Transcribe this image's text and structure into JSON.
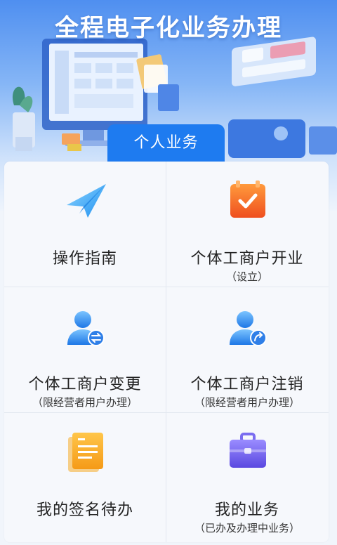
{
  "banner": {
    "title": "全程电子化业务办理"
  },
  "tab": {
    "label": "个人业务"
  },
  "items": [
    {
      "label": "操作指南",
      "sub": "",
      "icon": "paper-plane-icon"
    },
    {
      "label": "个体工商户开业",
      "sub": "（设立）",
      "icon": "calendar-check-icon"
    },
    {
      "label": "个体工商户变更",
      "sub": "（限经营者用户办理）",
      "icon": "user-swap-icon"
    },
    {
      "label": "个体工商户注销",
      "sub": "（限经营者用户办理）",
      "icon": "user-logout-icon"
    },
    {
      "label": "我的签名待办",
      "sub": "",
      "icon": "document-icon"
    },
    {
      "label": "我的业务",
      "sub": "（已办及办理中业务）",
      "icon": "briefcase-icon"
    }
  ],
  "colors": {
    "accent": "#1e7bf0",
    "orange": "#f26a2a",
    "purple": "#6b5de8"
  }
}
